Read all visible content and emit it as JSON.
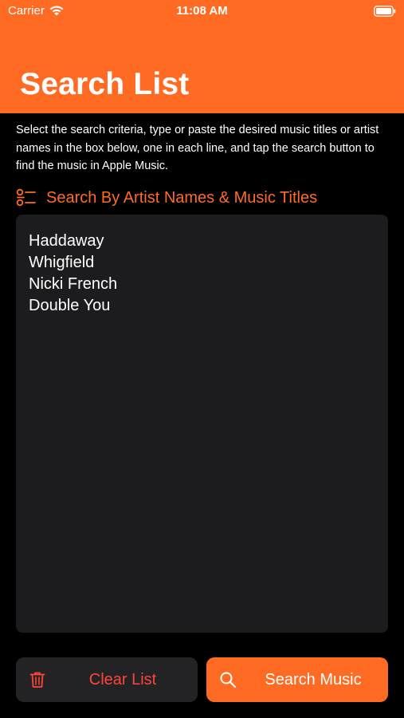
{
  "status_bar": {
    "carrier": "Carrier",
    "time": "11:08 AM"
  },
  "header": {
    "title": "Search List",
    "background_color": "#FF6B22"
  },
  "instructions": "Select the search criteria, type or paste the desired music titles or artist names in the box below, one in each line, and tap the search button to find the music in Apple Music.",
  "criteria": {
    "icon": "list-settings-icon",
    "label": "Search By Artist Names & Music Titles"
  },
  "search_list": {
    "lines": [
      "Haddaway",
      "Whigfield",
      "Nicki French",
      "Double You"
    ]
  },
  "buttons": {
    "clear": {
      "label": "Clear List",
      "icon": "trash-icon",
      "color": "#FF453A"
    },
    "search": {
      "label": "Search Music",
      "icon": "search-icon"
    }
  },
  "accent_color": "#FF6B22"
}
